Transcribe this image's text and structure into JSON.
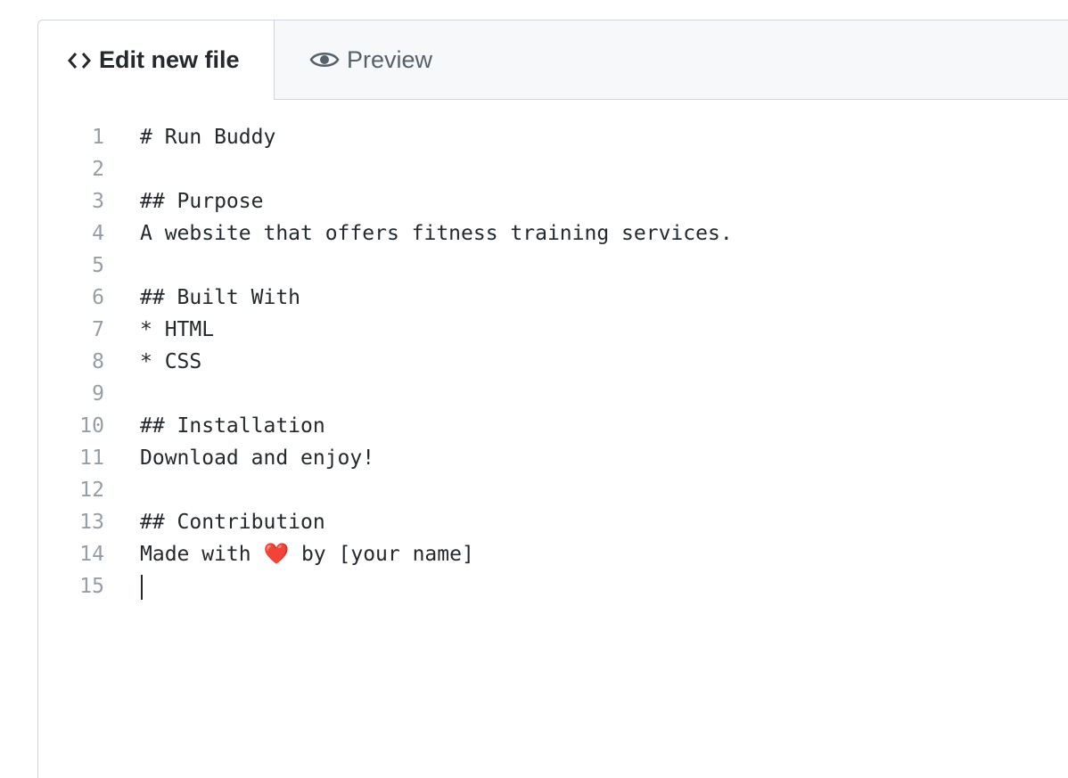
{
  "tabs": {
    "edit": {
      "label": "Edit new file",
      "icon": "code-icon"
    },
    "preview": {
      "label": "Preview",
      "icon": "eye-icon"
    }
  },
  "editor": {
    "lines": [
      {
        "number": "1",
        "text": "# Run Buddy"
      },
      {
        "number": "2",
        "text": ""
      },
      {
        "number": "3",
        "text": "## Purpose"
      },
      {
        "number": "4",
        "text": "A website that offers fitness training services."
      },
      {
        "number": "5",
        "text": ""
      },
      {
        "number": "6",
        "text": "## Built With"
      },
      {
        "number": "7",
        "text": "* HTML"
      },
      {
        "number": "8",
        "text": "* CSS"
      },
      {
        "number": "9",
        "text": ""
      },
      {
        "number": "10",
        "text": "## Installation"
      },
      {
        "number": "11",
        "text": "Download and enjoy!"
      },
      {
        "number": "12",
        "text": ""
      },
      {
        "number": "13",
        "text": "## Contribution"
      },
      {
        "number": "14",
        "text": "Made with ❤️ by [your name]"
      },
      {
        "number": "15",
        "text": ""
      }
    ]
  },
  "colors": {
    "text": "#24292e",
    "muted": "#586069",
    "line_number": "#959da5",
    "border": "#d1d5da",
    "tabbar_bg": "#f6f8fa"
  }
}
